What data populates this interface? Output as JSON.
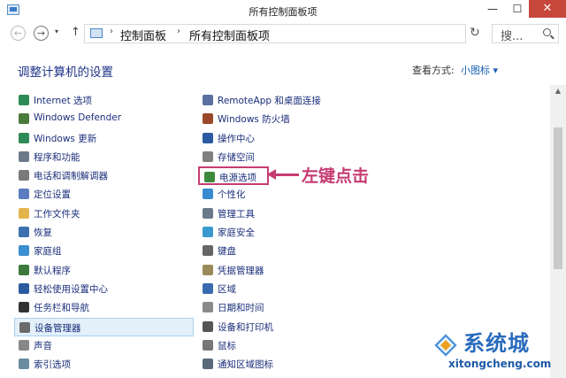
{
  "window": {
    "title": "所有控制面板项",
    "min": "—",
    "max": "☐",
    "close": "✕"
  },
  "nav": {
    "back": "←",
    "forward": "→",
    "dropdown": "▾",
    "up": "↑",
    "crumbs": [
      "控制面板",
      "所有控制面板项"
    ],
    "separator": "›",
    "refresh": "↻",
    "search_placeholder": "搜..."
  },
  "heading": "调整计算机的设置",
  "view_by": {
    "label": "查看方式:",
    "value": "小图标 ▾"
  },
  "columns": [
    [
      {
        "label": "Internet 选项",
        "icon": "globe-icon",
        "color": "#2e8b57"
      },
      {
        "label": "Windows Defender",
        "icon": "castle-icon",
        "color": "#4a7a3a"
      },
      {
        "label": "Windows 更新",
        "icon": "update-icon",
        "color": "#2e8b57"
      },
      {
        "label": "程序和功能",
        "icon": "programs-icon",
        "color": "#6c7a89"
      },
      {
        "label": "电话和调制解调器",
        "icon": "phone-icon",
        "color": "#7a7a7a"
      },
      {
        "label": "定位设置",
        "icon": "location-icon",
        "color": "#5b7cc0"
      },
      {
        "label": "工作文件夹",
        "icon": "folder-icon",
        "color": "#e3b44a"
      },
      {
        "label": "恢复",
        "icon": "recovery-icon",
        "color": "#3b6fb0"
      },
      {
        "label": "家庭组",
        "icon": "homegroup-icon",
        "color": "#3a8fd0"
      },
      {
        "label": "默认程序",
        "icon": "default-programs-icon",
        "color": "#3b7a3b"
      },
      {
        "label": "轻松使用设置中心",
        "icon": "ease-of-access-icon",
        "color": "#2c5aa0"
      },
      {
        "label": "任务栏和导航",
        "icon": "taskbar-icon",
        "color": "#333333"
      },
      {
        "label": "设备管理器",
        "icon": "device-manager-icon",
        "color": "#6a6a6a"
      },
      {
        "label": "声音",
        "icon": "sound-icon",
        "color": "#888888"
      },
      {
        "label": "索引选项",
        "icon": "index-icon",
        "color": "#6a8aa0"
      }
    ],
    [
      {
        "label": "RemoteApp 和桌面连接",
        "icon": "remoteapp-icon",
        "color": "#5b6fa0"
      },
      {
        "label": "Windows 防火墙",
        "icon": "firewall-icon",
        "color": "#9a4a2a"
      },
      {
        "label": "操作中心",
        "icon": "flag-icon",
        "color": "#2c5aa0"
      },
      {
        "label": "存储空间",
        "icon": "storage-icon",
        "color": "#808080"
      },
      {
        "label": "电源选项",
        "icon": "power-icon",
        "color": "#3c8a3c"
      },
      {
        "label": "个性化",
        "icon": "personalization-icon",
        "color": "#3a8ad0"
      },
      {
        "label": "管理工具",
        "icon": "admin-tools-icon",
        "color": "#6a7a8a"
      },
      {
        "label": "家庭安全",
        "icon": "family-safety-icon",
        "color": "#3a9ad0"
      },
      {
        "label": "键盘",
        "icon": "keyboard-icon",
        "color": "#666666"
      },
      {
        "label": "凭据管理器",
        "icon": "credential-icon",
        "color": "#9a8a5a"
      },
      {
        "label": "区域",
        "icon": "region-icon",
        "color": "#3a6ab0"
      },
      {
        "label": "日期和时间",
        "icon": "clock-icon",
        "color": "#8a8a8a"
      },
      {
        "label": "设备和打印机",
        "icon": "printer-icon",
        "color": "#555555"
      },
      {
        "label": "鼠标",
        "icon": "mouse-icon",
        "color": "#777777"
      },
      {
        "label": "通知区域图标",
        "icon": "notification-icon",
        "color": "#5a6a7a"
      }
    ]
  ],
  "annotation": "左键点击",
  "watermark": {
    "text": "系统城",
    "url": "xitongcheng.com"
  },
  "colors": {
    "link": "#1a2e7a",
    "annotation": "#c63c72",
    "accent": "#1a5fb4"
  }
}
